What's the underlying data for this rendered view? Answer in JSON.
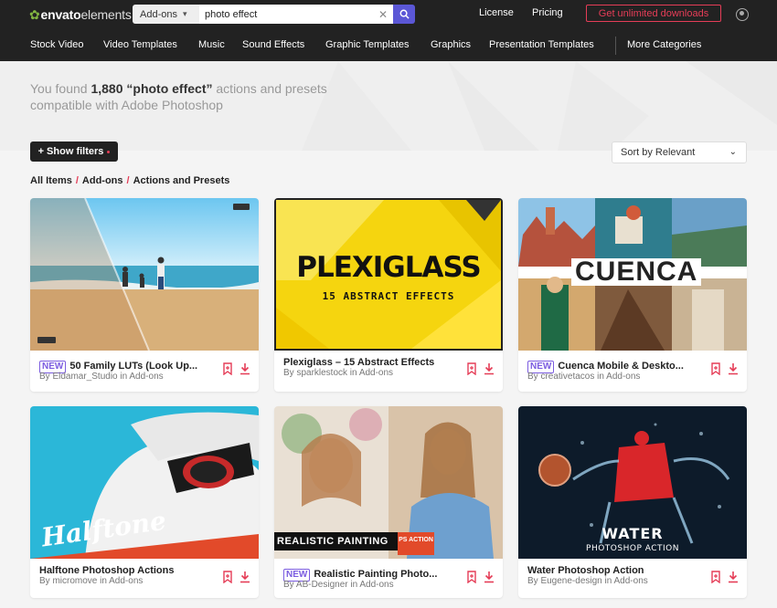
{
  "header": {
    "logo_part1": "envato",
    "logo_part2": "elements",
    "search_category": "Add-ons",
    "search_value": "photo effect",
    "links": [
      "License",
      "Pricing"
    ],
    "cta": "Get unlimited downloads"
  },
  "nav": [
    "Stock Video",
    "Video Templates",
    "Music",
    "Sound Effects",
    "Graphic Templates",
    "Graphics",
    "Presentation Templates",
    "More Categories"
  ],
  "results": {
    "prefix": "You found",
    "count": "1,880",
    "query": "“photo effect”",
    "suffix": "actions and presets",
    "line2": "compatible with Adobe Photoshop"
  },
  "filters_label": "+ Show filters",
  "sort_label": "Sort by Relevant",
  "breadcrumb": [
    "All Items",
    "Add-ons",
    "Actions and Presets"
  ],
  "badge_new": "NEW",
  "items": [
    {
      "title": "50 Family LUTs (Look Up...",
      "by": "By Eldamar_Studio in Add-ons",
      "is_new": true
    },
    {
      "title": "Plexiglass – 15 Abstract Effects",
      "by": "By sparklestock in Add-ons",
      "is_new": false,
      "art_title": "PLEXIGLASS",
      "art_sub": "15 ABSTRACT EFFECTS"
    },
    {
      "title": "Cuenca Mobile & Deskto...",
      "by": "By creativetacos in Add-ons",
      "is_new": true,
      "art_title": "CUENCA"
    },
    {
      "title": "Halftone Photoshop Actions",
      "by": "By micromove in Add-ons",
      "is_new": false,
      "art_title": "Halftone"
    },
    {
      "title": "Realistic Painting Photo...",
      "by": "By AB-Designer in Add-ons",
      "is_new": true,
      "art_title": "REALISTIC PAINTING",
      "art_tag": "PS ACTION"
    },
    {
      "title": "Water Photoshop Action",
      "by": "By Eugene-design in Add-ons",
      "is_new": false,
      "art_title": "WATER",
      "art_sub": "PHOTOSHOP ACTION"
    }
  ],
  "colors": {
    "accent": "#e53d57",
    "new_badge": "#7b5ce0",
    "search_button": "#5b57d6",
    "topbar": "#222222"
  }
}
